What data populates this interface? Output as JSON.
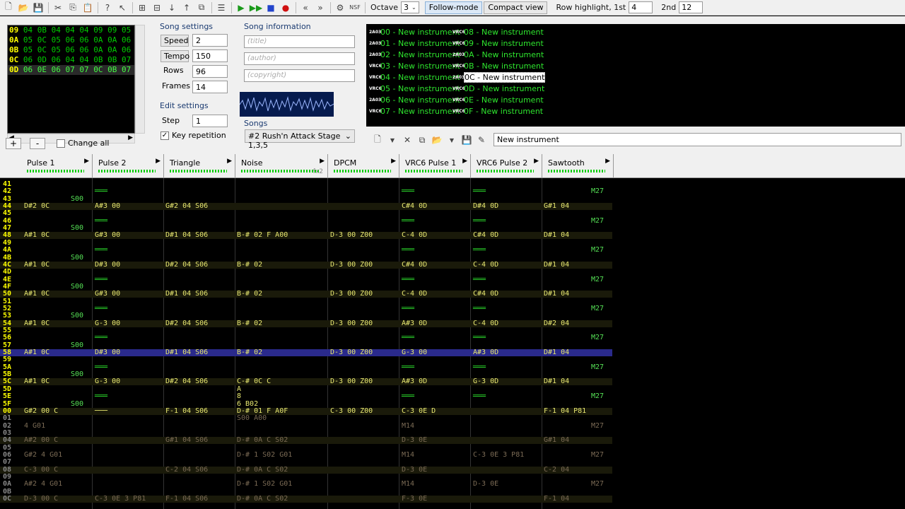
{
  "toolbar": {
    "octave_label": "Octave",
    "octave_value": "3",
    "follow_mode": "Follow-mode",
    "compact_view": "Compact view",
    "row_highlight_label": "Row highlight, 1st",
    "row_highlight_1st": "4",
    "second_label": "2nd",
    "row_highlight_2nd": "12",
    "nsf_label": "NSF"
  },
  "frames": {
    "rows": [
      {
        "n": "09",
        "d": "04 0B 04 04 04 09 09 05"
      },
      {
        "n": "0A",
        "d": "05 0C 05 06 06 0A 0A 06"
      },
      {
        "n": "0B",
        "d": "05 0C 05 06 06 0A 0A 06"
      },
      {
        "n": "0C",
        "d": "06 0D 06 04 04 0B 0B 07"
      },
      {
        "n": "0D",
        "d": "06 0E 06 07 07 0C 0B 07"
      }
    ],
    "add": "+",
    "remove": "-",
    "change_all": "Change all"
  },
  "song_settings": {
    "title": "Song settings",
    "speed_label": "Speed",
    "speed": "2",
    "tempo_label": "Tempo",
    "tempo": "150",
    "rows_label": "Rows",
    "rows": "96",
    "frames_label": "Frames",
    "frames": "14"
  },
  "edit_settings": {
    "title": "Edit settings",
    "step_label": "Step",
    "step": "1",
    "key_repetition": "Key repetition"
  },
  "song_info": {
    "title": "Song information",
    "title_placeholder": "(title)",
    "author_placeholder": "(author)",
    "copyright_placeholder": "(copyright)",
    "songs_label": "Songs",
    "song_selected": "#2 Rush'n Attack Stage 1,3,5"
  },
  "instruments": [
    {
      "icon": "2A03",
      "label": "00 - New instrument"
    },
    {
      "icon": "2A03",
      "label": "01 - New instrument"
    },
    {
      "icon": "2A03",
      "label": "02 - New instrument"
    },
    {
      "icon": "VRC6",
      "label": "03 - New instrument"
    },
    {
      "icon": "VRC6",
      "label": "04 - New instrument"
    },
    {
      "icon": "VRC6",
      "label": "05 - New instrument"
    },
    {
      "icon": "2A03",
      "label": "06 - New instrument"
    },
    {
      "icon": "VRC6",
      "label": "07 - New instrument"
    },
    {
      "icon": "VRC6",
      "label": "08 - New instrument"
    },
    {
      "icon": "VRC6",
      "label": "09 - New instrument"
    },
    {
      "icon": "2A03",
      "label": "0A - New instrument"
    },
    {
      "icon": "VRC6",
      "label": "0B - New instrument"
    },
    {
      "icon": "2A03",
      "label": "0C - New instrument"
    },
    {
      "icon": "VRC6",
      "label": "0D - New instrument"
    },
    {
      "icon": "VRC6",
      "label": "0E - New instrument"
    },
    {
      "icon": "VRC6",
      "label": "0F - New instrument"
    }
  ],
  "selected_instrument_name": "New instrument",
  "channels": [
    {
      "name": "Pulse 1"
    },
    {
      "name": "Pulse 2"
    },
    {
      "name": "Triangle"
    },
    {
      "name": "Noise",
      "extra": "fx2"
    },
    {
      "name": "DPCM"
    },
    {
      "name": "VRC6 Pulse 1"
    },
    {
      "name": "VRC6 Pulse 2"
    },
    {
      "name": "Sawtooth"
    }
  ],
  "pattern_rows": [
    {
      "r": "41",
      "c": [
        "",
        "",
        "",
        "",
        "",
        "",
        "",
        ""
      ]
    },
    {
      "r": "42",
      "c": [
        "",
        "═══",
        "",
        "",
        "",
        "═══",
        "═══",
        "M27"
      ]
    },
    {
      "r": "43",
      "c": [
        "S00",
        "",
        "",
        "",
        "",
        "",
        "",
        ""
      ]
    },
    {
      "r": "44",
      "c": [
        "D#2 0C",
        "A#3 00",
        "G#2 04 S06",
        "",
        "",
        "C#4 0D",
        "D#4 0D",
        "G#1 04"
      ]
    },
    {
      "r": "45",
      "c": [
        "",
        "",
        "",
        "",
        "",
        "",
        "",
        ""
      ]
    },
    {
      "r": "46",
      "c": [
        "",
        "═══",
        "",
        "",
        "",
        "═══",
        "═══",
        "M27"
      ]
    },
    {
      "r": "47",
      "c": [
        "S00",
        "",
        "",
        "",
        "",
        "",
        "",
        ""
      ]
    },
    {
      "r": "48",
      "c": [
        "A#1 0C",
        "G#3 00",
        "D#1 04 S06",
        "B-# 02 F A00",
        "D-3 00 Z00",
        "C-4 0D",
        "C#4 0D",
        "D#1 04"
      ]
    },
    {
      "r": "49",
      "c": [
        "",
        "",
        "",
        "",
        "",
        "",
        "",
        ""
      ]
    },
    {
      "r": "4A",
      "c": [
        "",
        "═══",
        "",
        "",
        "",
        "═══",
        "═══",
        "M27"
      ]
    },
    {
      "r": "4B",
      "c": [
        "S00",
        "",
        "",
        "",
        "",
        "",
        "",
        ""
      ]
    },
    {
      "r": "4C",
      "c": [
        "A#1 0C",
        "D#3 00",
        "D#2 04 S06",
        "B-# 02",
        "D-3 00 Z00",
        "C#4 0D",
        "C-4 0D",
        "D#1 04"
      ]
    },
    {
      "r": "4D",
      "c": [
        "",
        "",
        "",
        "",
        "",
        "",
        "",
        ""
      ]
    },
    {
      "r": "4E",
      "c": [
        "",
        "═══",
        "",
        "",
        "",
        "═══",
        "═══",
        "M27"
      ]
    },
    {
      "r": "4F",
      "c": [
        "S00",
        "",
        "",
        "",
        "",
        "",
        "",
        ""
      ]
    },
    {
      "r": "50",
      "c": [
        "A#1 0C",
        "G#3 00",
        "D#1 04 S06",
        "B-# 02",
        "D-3 00 Z00",
        "C-4 0D",
        "C#4 0D",
        "D#1 04"
      ]
    },
    {
      "r": "51",
      "c": [
        "",
        "",
        "",
        "",
        "",
        "",
        "",
        ""
      ]
    },
    {
      "r": "52",
      "c": [
        "",
        "═══",
        "",
        "",
        "",
        "═══",
        "═══",
        "M27"
      ]
    },
    {
      "r": "53",
      "c": [
        "S00",
        "",
        "",
        "",
        "",
        "",
        "",
        ""
      ]
    },
    {
      "r": "54",
      "c": [
        "A#1 0C",
        "G-3 00",
        "D#2 04 S06",
        "B-# 02",
        "D-3 00 Z00",
        "A#3 0D",
        "C-4 0D",
        "D#2 04"
      ]
    },
    {
      "r": "55",
      "c": [
        "",
        "",
        "",
        "",
        "",
        "",
        "",
        ""
      ]
    },
    {
      "r": "56",
      "c": [
        "",
        "═══",
        "",
        "",
        "",
        "═══",
        "═══",
        "M27"
      ]
    },
    {
      "r": "57",
      "c": [
        "S00",
        "",
        "",
        "",
        "",
        "",
        "",
        ""
      ]
    },
    {
      "r": "58",
      "c": [
        "A#1 0C",
        "D#3 00",
        "D#1 04 S06",
        "B-# 02",
        "D-3 00 Z00",
        "G-3 00",
        "A#3 0D",
        "D#1 04"
      ]
    },
    {
      "r": "59",
      "c": [
        "",
        "",
        "",
        "",
        "",
        "",
        "",
        ""
      ]
    },
    {
      "r": "5A",
      "c": [
        "",
        "═══",
        "",
        "",
        "",
        "═══",
        "═══",
        "M27"
      ]
    },
    {
      "r": "5B",
      "c": [
        "S00",
        "",
        "",
        "",
        "",
        "",
        "",
        ""
      ]
    },
    {
      "r": "5C",
      "c": [
        "A#1 0C",
        "G-3 00",
        "D#2 04 S06",
        "C-# 0C C",
        "D-3 00 Z00",
        "A#3 0D",
        "G-3 0D",
        "D#1 04"
      ]
    },
    {
      "r": "5D",
      "c": [
        "",
        "",
        "",
        "A",
        "",
        "",
        "",
        ""
      ]
    },
    {
      "r": "5E",
      "c": [
        "",
        "═══",
        "",
        "8",
        "",
        "═══",
        "═══",
        "M27"
      ]
    },
    {
      "r": "5F",
      "c": [
        "S00",
        "",
        "",
        "6 B02",
        "",
        "",
        "",
        ""
      ]
    },
    {
      "r": "00",
      "c": [
        "G#2 00 C",
        "───",
        "F-1 04 S06",
        "D-# 01 F A0F",
        "C-3 00 Z00",
        "C-3 0E D",
        "",
        "F-1 04 P81"
      ]
    },
    {
      "r": "01",
      "c": [
        "",
        "",
        "",
        "S00 A00",
        "",
        "",
        "",
        ""
      ]
    },
    {
      "r": "02",
      "c": [
        "4 G01",
        "",
        "",
        "",
        "",
        "M14",
        "",
        "M27"
      ]
    },
    {
      "r": "03",
      "c": [
        "",
        "",
        "",
        "",
        "",
        "",
        "",
        ""
      ]
    },
    {
      "r": "04",
      "c": [
        "A#2 00 C",
        "",
        "G#1 04 S06",
        "D-# 0A C S02",
        "",
        "D-3 0E",
        "",
        "G#1 04"
      ]
    },
    {
      "r": "05",
      "c": [
        "",
        "",
        "",
        "",
        "",
        "",
        "",
        ""
      ]
    },
    {
      "r": "06",
      "c": [
        "G#2 4 G01",
        "",
        "",
        "D-# 1 S02 G01",
        "",
        "M14",
        "C-3 0E 3 P81",
        "M27"
      ]
    },
    {
      "r": "07",
      "c": [
        "",
        "",
        "",
        "",
        "",
        "",
        "",
        ""
      ]
    },
    {
      "r": "08",
      "c": [
        "C-3 00 C",
        "",
        "C-2 04 S06",
        "D-# 0A C S02",
        "",
        "D-3 0E",
        "",
        "C-2 04"
      ]
    },
    {
      "r": "09",
      "c": [
        "",
        "",
        "",
        "",
        "",
        "",
        "",
        ""
      ]
    },
    {
      "r": "0A",
      "c": [
        "A#2 4 G01",
        "",
        "",
        "D-# 1 S02 G01",
        "",
        "M14",
        "D-3 0E",
        "M27"
      ]
    },
    {
      "r": "0B",
      "c": [
        "",
        "",
        "",
        "",
        "",
        "",
        "",
        ""
      ]
    },
    {
      "r": "0C",
      "c": [
        "D-3 00 C",
        "C-3 0E 3 P81",
        "F-1 04 S06",
        "D-# 0A C S02",
        "",
        "F-3 0E",
        "",
        "F-1 04"
      ]
    }
  ]
}
